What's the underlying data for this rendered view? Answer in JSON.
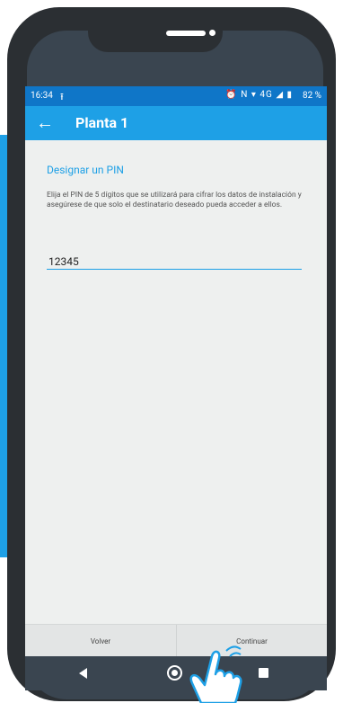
{
  "status_bar": {
    "time": "16:34",
    "upload_icon": "upload-icon",
    "icons": "⏰ N ▾ 4G ◢ ▮",
    "battery": "82 %"
  },
  "app_bar": {
    "title": "Planta 1"
  },
  "main": {
    "heading": "Designar un PIN",
    "description": "Elija el PIN de 5 dígitos que se utilizará para cifrar los datos de instalación y asegúrese de que solo el destinatario deseado pueda acceder a ellos.",
    "pin_value": "12345"
  },
  "footer": {
    "back_label": "Volver",
    "continue_label": "Continuar"
  },
  "colors": {
    "accent": "#1ea0e6",
    "status_bar": "#0f76c8",
    "background": "#eef0ef"
  }
}
